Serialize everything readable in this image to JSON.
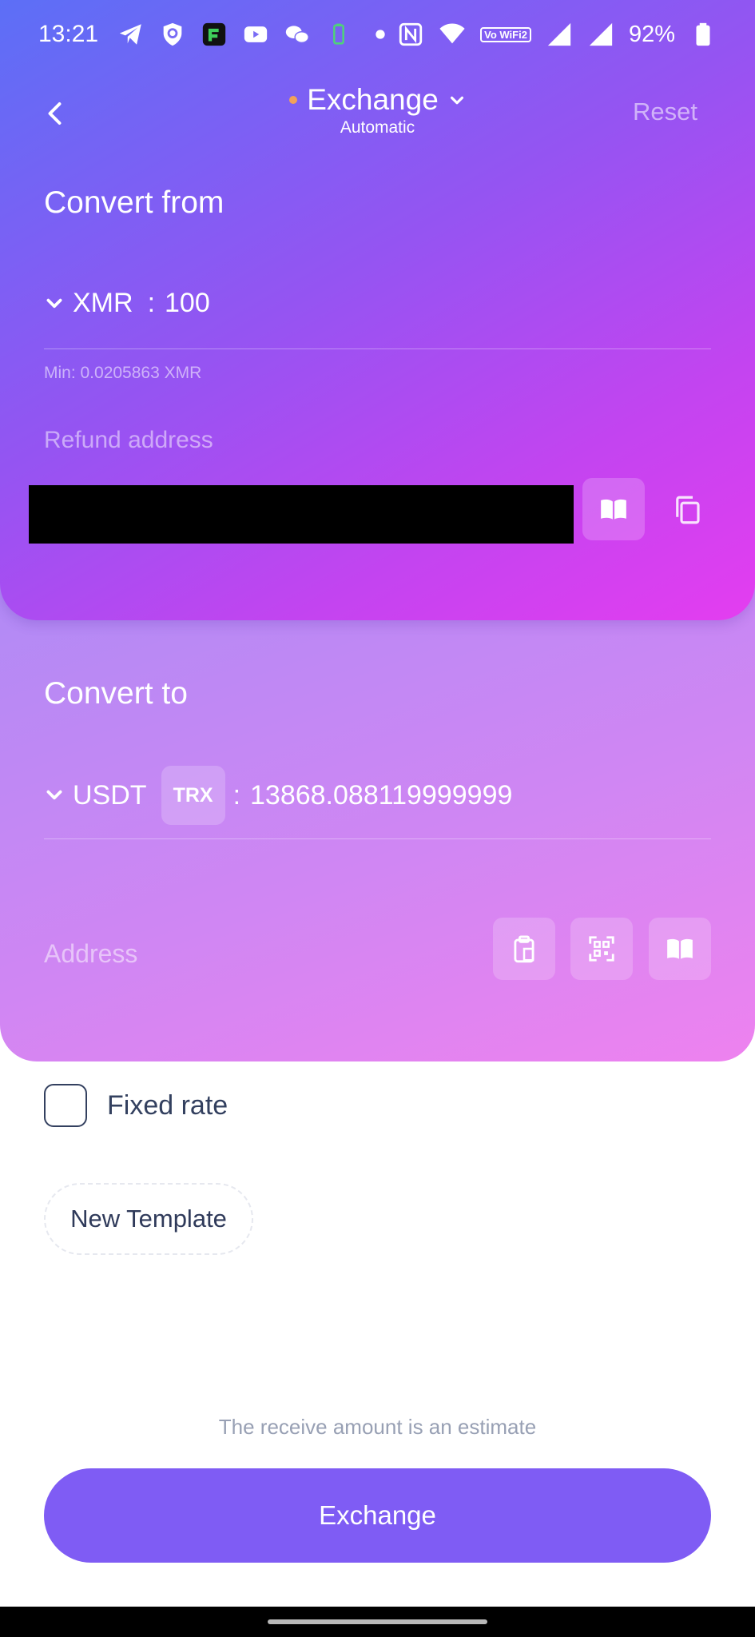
{
  "status_bar": {
    "time": "13:21",
    "left_icons": [
      "telegram-icon",
      "shield-icon",
      "app-icon",
      "youtube-icon",
      "wechat-icon",
      "battery-saver-icon",
      "dot-icon"
    ],
    "right_icons": [
      "nfc-icon",
      "wifi-icon",
      "vowifi-icon",
      "signal-icon",
      "signal-icon",
      "battery-icon"
    ],
    "vowifi_label": "Vo WiFi2",
    "battery": "92%"
  },
  "header": {
    "title": "Exchange",
    "subtitle": "Automatic",
    "reset_label": "Reset",
    "status_dot_color": "#f2a15a"
  },
  "convert_from": {
    "title": "Convert from",
    "currency": "XMR",
    "separator": ":",
    "amount": "100",
    "min_text": "Min: 0.0205863 XMR",
    "refund_label": "Refund address"
  },
  "convert_to": {
    "title": "Convert to",
    "currency": "USDT",
    "network": "TRX",
    "separator": ":",
    "amount": "13868.088119999999",
    "address_label": "Address"
  },
  "options": {
    "fixed_rate_label": "Fixed rate",
    "fixed_rate_checked": false,
    "new_template_label": "New Template"
  },
  "footer": {
    "estimate_note": "The receive amount is an estimate",
    "exchange_button": "Exchange"
  },
  "colors": {
    "primary_button": "#7f5cf4",
    "text_dark": "#2f3a5a"
  }
}
